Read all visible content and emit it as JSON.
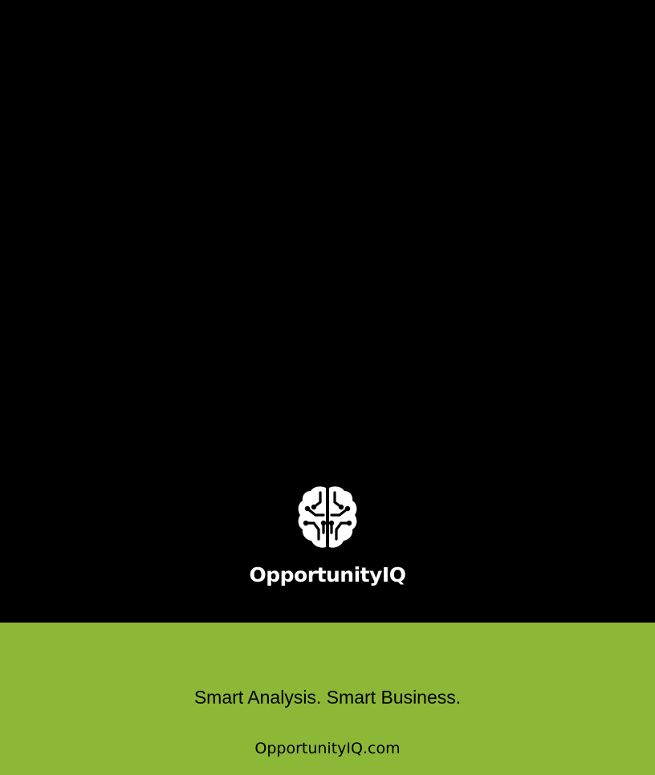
{
  "brand": {
    "name": "OpportunityIQ",
    "icon": "brain-icon"
  },
  "footer": {
    "tagline": "Smart Analysis. Smart Business.",
    "website": "OpportunityIQ.com"
  },
  "colors": {
    "background": "#000000",
    "accent": "#8db736",
    "logo": "#ffffff"
  }
}
